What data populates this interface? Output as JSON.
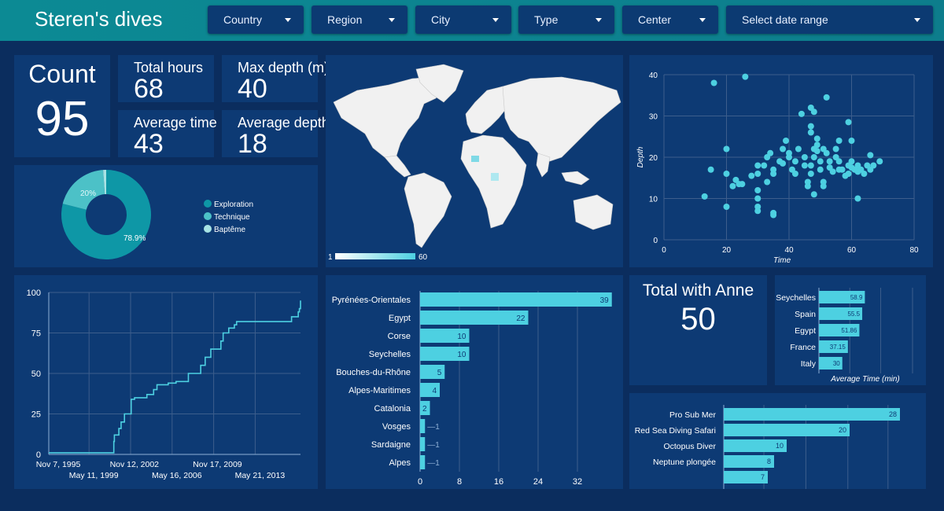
{
  "header": {
    "title": "Steren's dives",
    "filters": [
      "Country",
      "Region",
      "City",
      "Type",
      "Center",
      "Select date range"
    ]
  },
  "kpis": {
    "count": {
      "label": "Count",
      "value": "95"
    },
    "total_hours": {
      "label": "Total hours",
      "value": "68"
    },
    "max_depth": {
      "label": "Max depth (m)",
      "value": "40"
    },
    "average_time": {
      "label": "Average time",
      "value": "43"
    },
    "average_depth": {
      "label": "Average depth",
      "value": "18"
    },
    "total_with_anne": {
      "label": "Total with Anne",
      "value": "50"
    }
  },
  "colors": {
    "accent": "#4dd0e1",
    "panel": "#0d3a74",
    "background": "#0b2d5e",
    "header": "#0c8a94",
    "donut_main": "#0e97a6",
    "donut_mid": "#4cc1c7",
    "donut_light": "#a7e3e4"
  },
  "map": {
    "legend_min": "1",
    "legend_max": "60"
  },
  "chart_data": [
    {
      "id": "dive-types",
      "type": "pie",
      "categories": [
        "Exploration",
        "Technique",
        "Baptême"
      ],
      "values": [
        78.9,
        20,
        1.1
      ],
      "data_labels": [
        "78.9%",
        "20%",
        ""
      ],
      "legend": "right"
    },
    {
      "id": "depth-vs-time",
      "type": "scatter",
      "xlabel": "Time",
      "ylabel": "Depth",
      "xlim": [
        0,
        80
      ],
      "ylim": [
        0,
        40
      ],
      "xticks": [
        "0",
        "20",
        "40",
        "60",
        "80"
      ],
      "yticks": [
        "0",
        "10",
        "20",
        "30",
        "40"
      ],
      "points": [
        [
          16,
          38
        ],
        [
          26,
          39.5
        ],
        [
          13,
          10.5
        ],
        [
          15,
          17
        ],
        [
          20,
          8
        ],
        [
          20,
          16
        ],
        [
          20,
          22
        ],
        [
          22,
          13
        ],
        [
          23,
          14.5
        ],
        [
          24,
          13.5
        ],
        [
          25,
          13.5
        ],
        [
          28,
          15.5
        ],
        [
          30,
          18
        ],
        [
          30,
          16
        ],
        [
          30,
          12
        ],
        [
          30,
          10
        ],
        [
          30,
          8
        ],
        [
          30,
          7
        ],
        [
          32,
          18
        ],
        [
          33,
          14
        ],
        [
          33,
          20
        ],
        [
          34,
          21
        ],
        [
          35,
          17
        ],
        [
          35,
          16
        ],
        [
          35,
          6.5
        ],
        [
          35,
          6
        ],
        [
          37,
          19
        ],
        [
          38,
          22
        ],
        [
          38,
          18.5
        ],
        [
          39,
          24
        ],
        [
          40,
          21
        ],
        [
          40,
          20
        ],
        [
          41,
          17
        ],
        [
          42,
          19
        ],
        [
          42,
          16
        ],
        [
          43,
          22
        ],
        [
          44,
          30.5
        ],
        [
          45,
          20
        ],
        [
          45,
          18
        ],
        [
          46,
          14
        ],
        [
          46,
          13
        ],
        [
          47,
          32
        ],
        [
          47,
          27.5
        ],
        [
          47,
          26
        ],
        [
          47,
          18
        ],
        [
          47,
          16
        ],
        [
          48,
          31
        ],
        [
          48,
          22
        ],
        [
          48,
          20
        ],
        [
          48,
          11
        ],
        [
          49,
          24.5
        ],
        [
          49,
          23
        ],
        [
          49,
          21.5
        ],
        [
          50,
          19
        ],
        [
          50,
          17
        ],
        [
          51,
          22
        ],
        [
          51,
          14
        ],
        [
          51,
          13
        ],
        [
          52,
          34.5
        ],
        [
          52,
          21
        ],
        [
          53,
          19
        ],
        [
          53,
          17.5
        ],
        [
          54,
          16.5
        ],
        [
          55,
          20
        ],
        [
          55,
          22
        ],
        [
          56,
          19
        ],
        [
          56,
          17
        ],
        [
          56,
          24
        ],
        [
          57,
          17
        ],
        [
          58,
          15.5
        ],
        [
          59,
          28.5
        ],
        [
          59,
          18
        ],
        [
          59,
          16
        ],
        [
          60,
          24
        ],
        [
          60,
          19
        ],
        [
          60,
          17.5
        ],
        [
          61,
          17
        ],
        [
          62,
          18
        ],
        [
          62,
          16.5
        ],
        [
          62,
          10
        ],
        [
          63,
          17
        ],
        [
          64,
          16
        ],
        [
          65,
          18
        ],
        [
          66,
          20.5
        ],
        [
          66,
          17
        ],
        [
          67,
          18
        ],
        [
          69,
          19
        ]
      ]
    },
    {
      "id": "cumulative-dives",
      "type": "line",
      "xlabels_top": [
        "Nov 7, 1995",
        "Nov 12, 2002",
        "Nov 17, 2009"
      ],
      "xlabels_bottom": [
        "May 11, 1999",
        "May 16, 2006",
        "May 21, 2013"
      ],
      "yticks": [
        "0",
        "25",
        "50",
        "75",
        "100"
      ],
      "ylim": [
        0,
        100
      ],
      "xlim": [
        1995.85,
        2018.3
      ],
      "x": [
        1995.85,
        2001.55,
        2001.65,
        2001.7,
        2002.1,
        2002.3,
        2002.6,
        2003.0,
        2003.2,
        2003.5,
        2004.6,
        2005.2,
        2005.5,
        2006.5,
        2007.2,
        2008.3,
        2009.4,
        2009.8,
        2010.3,
        2011.2,
        2011.4,
        2011.9,
        2012.4,
        2012.6,
        2013.0,
        2014.3,
        2016.4,
        2017.5,
        2018.1,
        2018.1,
        2018.2,
        2018.3
      ],
      "y": [
        1,
        1,
        8,
        12,
        16,
        20,
        25,
        25,
        34,
        35,
        37,
        40,
        43,
        44,
        45,
        50,
        55,
        60,
        65,
        70,
        75,
        78,
        80,
        82,
        82,
        82,
        82,
        85,
        85,
        88,
        90,
        95
      ]
    },
    {
      "id": "dives-by-region",
      "type": "bar",
      "orientation": "horizontal",
      "categories": [
        "Pyrénées-Orientales",
        "Egypt",
        "Corse",
        "Seychelles",
        "Bouches-du-Rhône",
        "Alpes-Maritimes",
        "Catalonia",
        "Vosges",
        "Sardaigne",
        "Alpes"
      ],
      "values": [
        39,
        22,
        10,
        10,
        5,
        4,
        2,
        1,
        1,
        1
      ],
      "xticks": [
        "0",
        "8",
        "16",
        "24",
        "32"
      ],
      "xlim": [
        0,
        40
      ]
    },
    {
      "id": "average-time-by-country",
      "type": "bar",
      "orientation": "horizontal",
      "categories": [
        "Seychelles",
        "Spain",
        "Egypt",
        "France",
        "Italy"
      ],
      "values": [
        58.9,
        55.5,
        51.86,
        37.15,
        30
      ],
      "data_labels": [
        "58.9",
        "55.5",
        "51.86",
        "37.15",
        "30"
      ],
      "xlabel": "Average Time (min)",
      "xlim": [
        0,
        120
      ]
    },
    {
      "id": "dives-by-center",
      "type": "bar",
      "orientation": "horizontal",
      "categories": [
        "Pro Sub Mer",
        "Red Sea Diving Safari",
        "Octopus Diver",
        "Neptune plongée",
        ""
      ],
      "values": [
        28,
        20,
        10,
        8,
        7
      ],
      "xlim": [
        0,
        29
      ]
    }
  ]
}
